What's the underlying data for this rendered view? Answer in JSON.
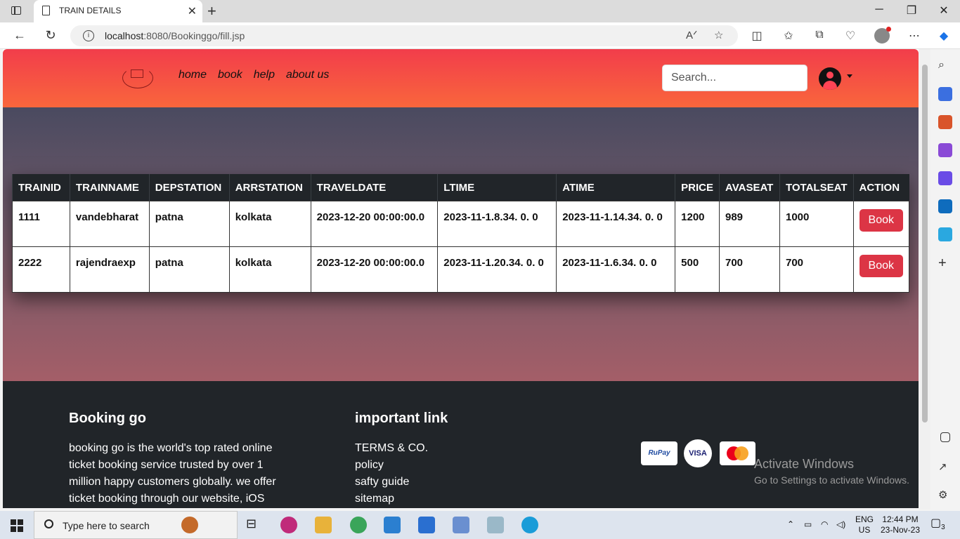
{
  "browser": {
    "tab_title": "TRAIN DETAILS",
    "url_host": "localhost",
    "url_rest": ":8080/Bookinggo/fill.jsp"
  },
  "navbar": {
    "links": [
      "home",
      "book",
      "help",
      "about us"
    ],
    "search_placeholder": "Search..."
  },
  "table": {
    "headers": [
      "TRAINID",
      "TRAINNAME",
      "DEPSTATION",
      "ARRSTATION",
      "TRAVELDATE",
      "LTIME",
      "ATIME",
      "PRICE",
      "AVASEAT",
      "TOTALSEAT",
      "ACTION"
    ],
    "rows": [
      [
        "1111",
        "vandebharat",
        "patna",
        "kolkata",
        "2023-12-20 00:00:00.0",
        "2023-11-1.8.34. 0. 0",
        "2023-11-1.14.34. 0. 0",
        "1200",
        "989",
        "1000",
        "Book"
      ],
      [
        "2222",
        "rajendraexp",
        "patna",
        "kolkata",
        "2023-12-20 00:00:00.0",
        "2023-11-1.20.34. 0. 0",
        "2023-11-1.6.34. 0. 0",
        "500",
        "700",
        "700",
        "Book"
      ]
    ]
  },
  "footer": {
    "brand": "Booking go",
    "about": "booking go is the world's top rated online ticket booking service trusted by over 1 million happy customers globally. we offer ticket booking through our website, iOS",
    "links_title": "important link",
    "links": [
      "TERMS & CO.",
      "policy",
      "safty guide",
      "sitemap"
    ],
    "payments": [
      "RuPay",
      "VISA"
    ]
  },
  "watermark": {
    "line1": "Activate Windows",
    "line2": "Go to Settings to activate Windows."
  },
  "taskbar": {
    "search_text": "Type here to search",
    "lang1": "ENG",
    "lang2": "US",
    "time": "12:44 PM",
    "date": "23-Nov-23",
    "notif_count": "3"
  }
}
